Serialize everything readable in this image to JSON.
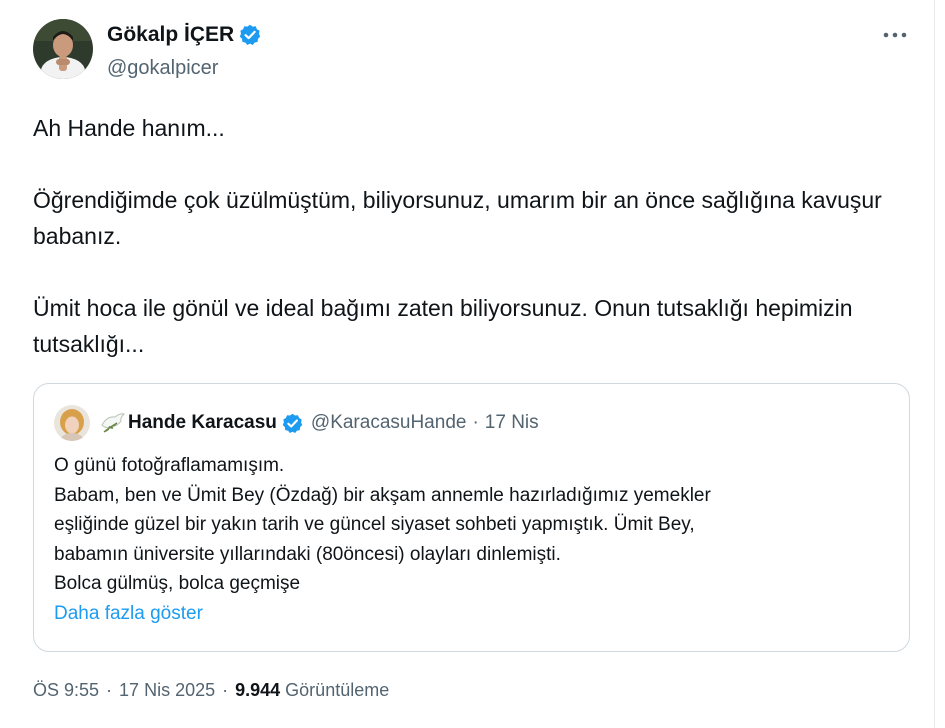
{
  "author": {
    "name": "Gökalp İÇER",
    "handle": "@gokalpicer",
    "verified": true,
    "avatar_icon": "profile-photo"
  },
  "more_icon": "more-horizontal-icon",
  "tweet": {
    "paragraphs": [
      "Ah Hande hanım...",
      "Öğrendiğimde çok üzülmüştüm, biliyorsunuz, umarım bir an önce sağlığına kavuşur babanız.",
      "Ümit hoca ile gönül ve ideal bağımı zaten biliyorsunuz. Onun tutsaklığı hepimizin tutsaklığı..."
    ]
  },
  "quote": {
    "name": "Hande Karacasu",
    "handle": "@KaracasuHande",
    "separator": "·",
    "date": "17 Nis",
    "verified": true,
    "dove_icon": "dove-olive-branch-icon",
    "lines": [
      "O günü fotoğraflamamışım.",
      "Babam, ben ve Ümit Bey (Özdağ) bir akşam annemle hazırladığımız yemekler",
      "eşliğinde güzel bir yakın tarih ve güncel siyaset sohbeti yapmıştık. Ümit Bey,",
      "babamın üniversite yıllarındaki (80öncesi) olayları dinlemişti.",
      "Bolca gülmüş, bolca geçmişe"
    ],
    "show_more": "Daha fazla göster"
  },
  "meta": {
    "time": "ÖS 9:55",
    "date": "17 Nis 2025",
    "sep1": "·",
    "sep2": "·",
    "views_count": "9.944",
    "views_label": "Görüntüleme"
  },
  "colors": {
    "verified_blue": "#1d9bf0",
    "secondary_text": "#536471",
    "primary_text": "#0f1419",
    "border": "#cfd9de"
  }
}
